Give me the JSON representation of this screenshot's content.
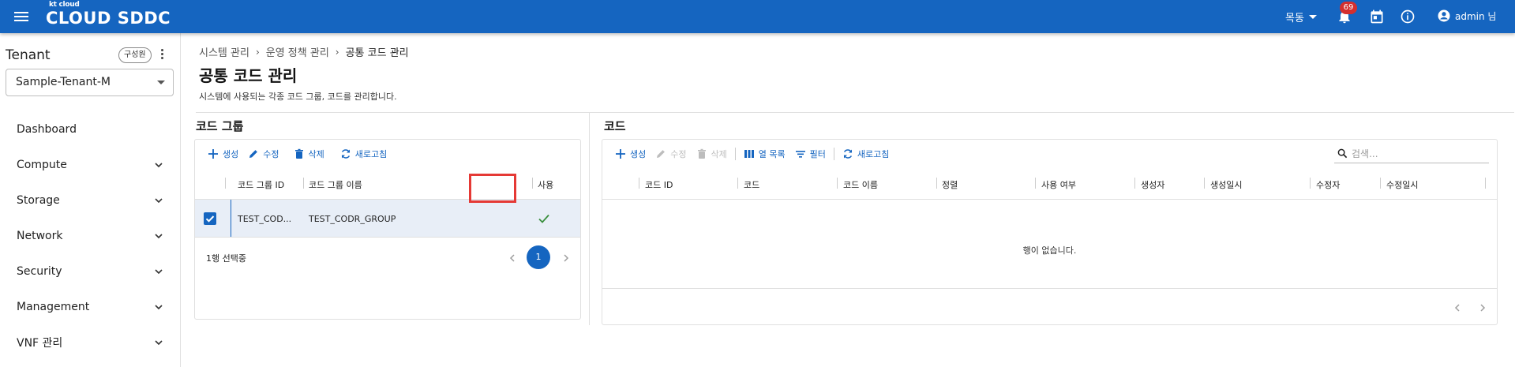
{
  "header": {
    "brand_small": "kt cloud",
    "brand_main": "CLOUD SDDC",
    "region": "목동",
    "notification_count": "69",
    "user": "admin 님"
  },
  "sidebar": {
    "tenant_title": "Tenant",
    "role_chip": "구성원",
    "tenant_selected": "Sample-Tenant-M",
    "items": [
      {
        "label": "Dashboard"
      },
      {
        "label": "Compute"
      },
      {
        "label": "Storage"
      },
      {
        "label": "Network"
      },
      {
        "label": "Security"
      },
      {
        "label": "Management"
      },
      {
        "label": "VNF 관리"
      }
    ]
  },
  "page": {
    "breadcrumb": [
      "시스템 관리",
      "운영 정책 관리",
      "공통 코드 관리"
    ],
    "title": "공통 코드 관리",
    "description": "시스템에 사용되는 각종 코드 그룹, 코드를 관리합니다."
  },
  "code_group": {
    "title": "코드 그룹",
    "toolbar": {
      "create": "생성",
      "edit": "수정",
      "delete": "삭제",
      "refresh": "새로고침"
    },
    "columns": [
      "코드 그룹 ID",
      "코드 그룹 이름",
      "사용"
    ],
    "rows": [
      {
        "id": "TEST_COD...",
        "name": "TEST_CODR_GROUP",
        "used": true
      }
    ],
    "selection": "1행 선택중",
    "page": "1"
  },
  "code": {
    "title": "코드",
    "toolbar": {
      "create": "생성",
      "edit": "수정",
      "delete": "삭제",
      "columns": "열 목록",
      "filter": "필터",
      "refresh": "새로고침"
    },
    "search_placeholder": "검색...",
    "columns": [
      "코드 ID",
      "코드",
      "코드 이름",
      "정렬",
      "사용 여부",
      "생성자",
      "생성일시",
      "수정자",
      "수정일시"
    ],
    "empty": "행이 없습니다."
  },
  "colors": {
    "primary": "#1565c0",
    "badge": "#d32f2f",
    "highlight": "#e53935",
    "selected_row": "#e8eef7"
  }
}
